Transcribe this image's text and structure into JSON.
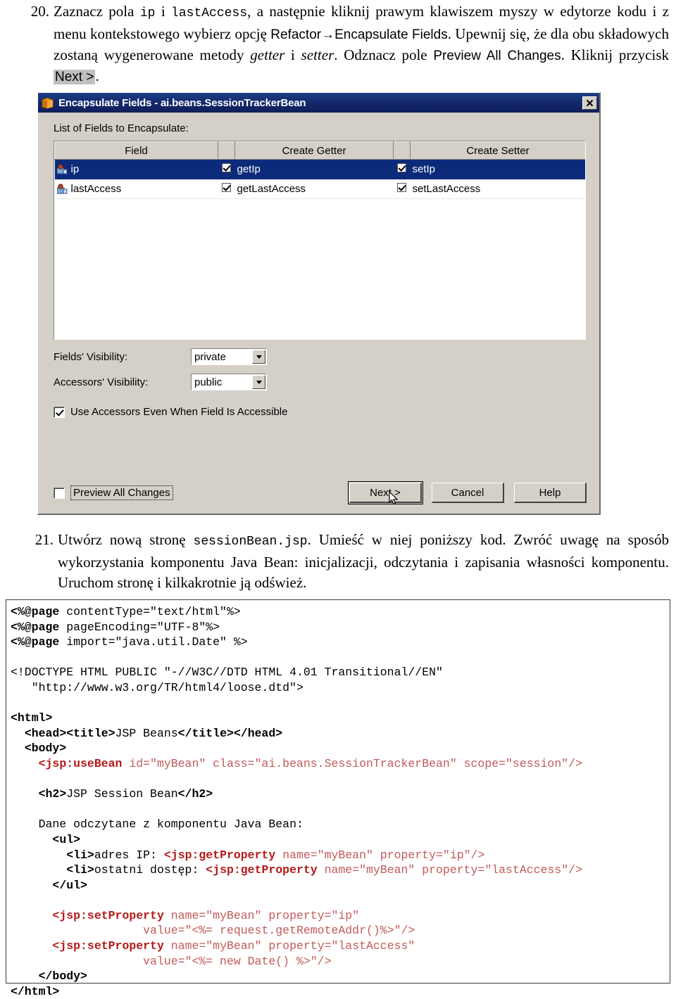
{
  "steps": [
    {
      "number": "20.",
      "parts": [
        {
          "t": "Zaznacz pola ",
          "s": "serif"
        },
        {
          "t": "ip",
          "s": "mono"
        },
        {
          "t": " i ",
          "s": "serif"
        },
        {
          "t": "lastAccess",
          "s": "mono"
        },
        {
          "t": ", a następnie kliknij prawym klawiszem myszy w edytorze kodu i z menu kontekstowego wybierz opcję ",
          "s": "serif"
        },
        {
          "t": "Refactor→Encapsulate Fields",
          "s": "ui"
        },
        {
          "t": ". Upewnij się, że dla obu składowych zostaną wygenerowane metody ",
          "s": "serif"
        },
        {
          "t": "getter",
          "s": "ital"
        },
        {
          "t": " i ",
          "s": "serif"
        },
        {
          "t": "setter",
          "s": "ital"
        },
        {
          "t": ". Odznacz pole ",
          "s": "serif"
        },
        {
          "t": "Preview All Changes",
          "s": "ui"
        },
        {
          "t": ". Kliknij przycisk ",
          "s": "serif"
        },
        {
          "t": "Next >",
          "s": "hl"
        },
        {
          "t": ".",
          "s": "serif"
        }
      ]
    },
    {
      "number": "21.",
      "parts": [
        {
          "t": "Utwórz nową stronę ",
          "s": "serif"
        },
        {
          "t": "sessionBean.jsp",
          "s": "mono"
        },
        {
          "t": ". Umieść w niej poniższy kod. Zwróć uwagę na sposób wykorzystania komponentu Java Bean: inicjalizacji, odczytania i zapisania własności komponentu. Uruchom stronę i kilkakrotnie ją odśwież.",
          "s": "serif"
        }
      ]
    }
  ],
  "dialog": {
    "title": "Encapsulate Fields - ai.beans.SessionTrackerBean",
    "close_label": "✕",
    "list_label": "List of Fields to Encapsulate:",
    "columns": [
      "Field",
      "",
      "Create Getter",
      "",
      "Create Setter"
    ],
    "rows": [
      {
        "field": "ip",
        "getter_checked": true,
        "getter": "getIp",
        "setter_checked": true,
        "setter": "setIp",
        "selected": true
      },
      {
        "field": "lastAccess",
        "getter_checked": true,
        "getter": "getLastAccess",
        "setter_checked": true,
        "setter": "setLastAccess",
        "selected": false
      }
    ],
    "fields_visibility_label": "Fields' Visibility:",
    "fields_visibility_value": "private",
    "accessors_visibility_label": "Accessors' Visibility:",
    "accessors_visibility_value": "public",
    "use_accessors_label": "Use Accessors Even When Field Is Accessible",
    "use_accessors_checked": true,
    "preview_all_changes_label": "Preview All Changes",
    "preview_all_changes_checked": false,
    "buttons": {
      "next": "Next >",
      "cancel": "Cancel",
      "help": "Help"
    },
    "colors": {
      "titlebar": "#12276b",
      "face": "#d4d0c8",
      "selection": "#0b2a7a",
      "icon_orange": "#e8901a"
    }
  },
  "code": {
    "lines": [
      [
        {
          "t": "<%@page",
          "c": "b"
        },
        {
          "t": " contentType=\"text/html\"%>",
          "c": ""
        }
      ],
      [
        {
          "t": "<%@page",
          "c": "b"
        },
        {
          "t": " pageEncoding=\"UTF-8\"%>",
          "c": ""
        }
      ],
      [
        {
          "t": "<%@page",
          "c": "b"
        },
        {
          "t": " import=\"java.util.Date\" %>",
          "c": ""
        }
      ],
      [],
      [
        {
          "t": "<!DOCTYPE HTML PUBLIC \"-//W3C//DTD HTML 4.01 Transitional//EN\"",
          "c": ""
        }
      ],
      [
        {
          "t": "   \"http://www.w3.org/TR/html4/loose.dtd\">",
          "c": ""
        }
      ],
      [],
      [
        {
          "t": "<html>",
          "c": "b"
        }
      ],
      [
        {
          "t": "  ",
          "c": ""
        },
        {
          "t": "<head>",
          "c": "b"
        },
        {
          "t": "<title>",
          "c": "b"
        },
        {
          "t": "JSP Beans",
          "c": ""
        },
        {
          "t": "</title>",
          "c": "b"
        },
        {
          "t": "</head>",
          "c": "b"
        }
      ],
      [
        {
          "t": "  ",
          "c": ""
        },
        {
          "t": "<body>",
          "c": "b"
        }
      ],
      [
        {
          "t": "    ",
          "c": ""
        },
        {
          "t": "<jsp:useBean",
          "c": "jsp"
        },
        {
          "t": " id=\"myBean\" class=\"ai.beans.SessionTrackerBean\" scope=\"session\"/>",
          "c": "jspattr"
        }
      ],
      [],
      [
        {
          "t": "    ",
          "c": ""
        },
        {
          "t": "<h2>",
          "c": "b"
        },
        {
          "t": "JSP Session Bean",
          "c": ""
        },
        {
          "t": "</h2>",
          "c": "b"
        }
      ],
      [],
      [
        {
          "t": "    Dane odczytane z komponentu Java Bean:",
          "c": ""
        }
      ],
      [
        {
          "t": "      ",
          "c": ""
        },
        {
          "t": "<ul>",
          "c": "b"
        }
      ],
      [
        {
          "t": "        ",
          "c": ""
        },
        {
          "t": "<li>",
          "c": "b"
        },
        {
          "t": "adres IP: ",
          "c": ""
        },
        {
          "t": "<jsp:getProperty",
          "c": "jsp"
        },
        {
          "t": " name=\"myBean\" property=\"ip\"/>",
          "c": "jspattr"
        }
      ],
      [
        {
          "t": "        ",
          "c": ""
        },
        {
          "t": "<li>",
          "c": "b"
        },
        {
          "t": "ostatni dostęp: ",
          "c": ""
        },
        {
          "t": "<jsp:getProperty",
          "c": "jsp"
        },
        {
          "t": " name=\"myBean\" property=\"lastAccess\"/>",
          "c": "jspattr"
        }
      ],
      [
        {
          "t": "      ",
          "c": ""
        },
        {
          "t": "</ul>",
          "c": "b"
        }
      ],
      [],
      [
        {
          "t": "      ",
          "c": ""
        },
        {
          "t": "<jsp:setProperty",
          "c": "jsp"
        },
        {
          "t": " name=\"myBean\" property=\"ip\"",
          "c": "jspattr"
        }
      ],
      [
        {
          "t": "                   value=\"<%= request.getRemoteAddr()%>\"/>",
          "c": "jspattr"
        }
      ],
      [
        {
          "t": "      ",
          "c": ""
        },
        {
          "t": "<jsp:setProperty",
          "c": "jsp"
        },
        {
          "t": " name=\"myBean\" property=\"lastAccess\"",
          "c": "jspattr"
        }
      ],
      [
        {
          "t": "                   value=\"<%= new Date() %>\"/>",
          "c": "jspattr"
        }
      ],
      [
        {
          "t": "    ",
          "c": ""
        },
        {
          "t": "</body>",
          "c": "b"
        }
      ],
      [
        {
          "t": "</html>",
          "c": "b"
        }
      ]
    ]
  }
}
